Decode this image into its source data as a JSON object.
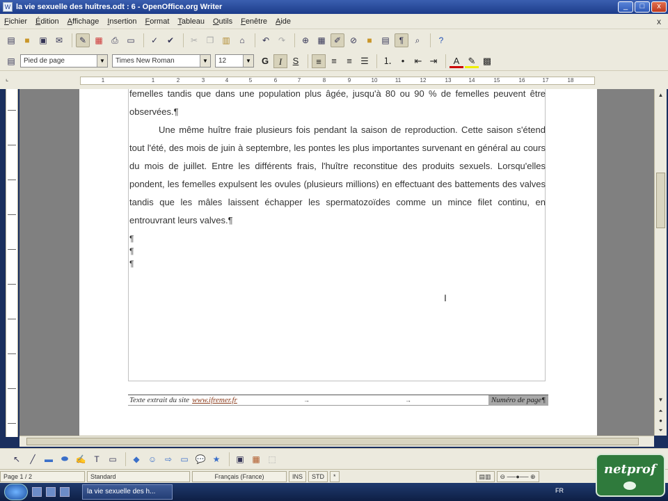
{
  "window": {
    "title": "la vie sexuelle des huîtres.odt : 6 - OpenOffice.org Writer",
    "buttons": [
      "_",
      "□",
      "x"
    ]
  },
  "menubar": {
    "items": [
      "Fichier",
      "Édition",
      "Affichage",
      "Insertion",
      "Format",
      "Tableau",
      "Outils",
      "Fenêtre",
      "Aide"
    ],
    "close_doc": "x"
  },
  "formatting": {
    "paragraph_style": "Pied de page",
    "font_name": "Times New Roman",
    "font_size": "12",
    "bold": "G",
    "italic": "I",
    "underline": "S"
  },
  "ruler": {
    "ticks": [
      "1",
      "1",
      "2",
      "3",
      "4",
      "5",
      "6",
      "7",
      "8",
      "9",
      "10",
      "11",
      "12",
      "13",
      "14",
      "15",
      "16",
      "17",
      "18"
    ]
  },
  "document": {
    "para1": "femelles tandis que dans une population plus âgée, jusqu'à 80 ou 90 % de femelles peuvent être observées.¶",
    "para2": "Une même huître fraie plusieurs fois pendant la saison de reproduction. Cette saison s'étend tout l'été, des mois de juin à septembre, les pontes les plus importantes survenant en général au cours du mois de juillet. Entre les différents frais, l'huître reconstitue des produits sexuels. Lorsqu'elles pondent, les femelles expulsent les ovules (plusieurs millions) en effectuant des battements des valves tandis que les mâles laissent échapper les spermatozoïdes comme un mince filet continu, en entrouvrant leurs valves.¶",
    "empty_marks": [
      "¶",
      "¶",
      "¶"
    ],
    "cursor_glyph": "I"
  },
  "footer": {
    "text": "Texte extrait du site",
    "link": "www.ifremer.fr",
    "tab_mark": "→",
    "page_number_field": "Numéro de page",
    "end_mark": "¶"
  },
  "status": {
    "page": "Page 1 / 2",
    "style": "Standard",
    "language": "Français (France)",
    "ins": "INS",
    "std": "STD",
    "star": "*"
  },
  "taskbar": {
    "task_label": "la vie sexuelle des h...",
    "tray": "FR"
  },
  "logo": {
    "text": "netprof"
  }
}
